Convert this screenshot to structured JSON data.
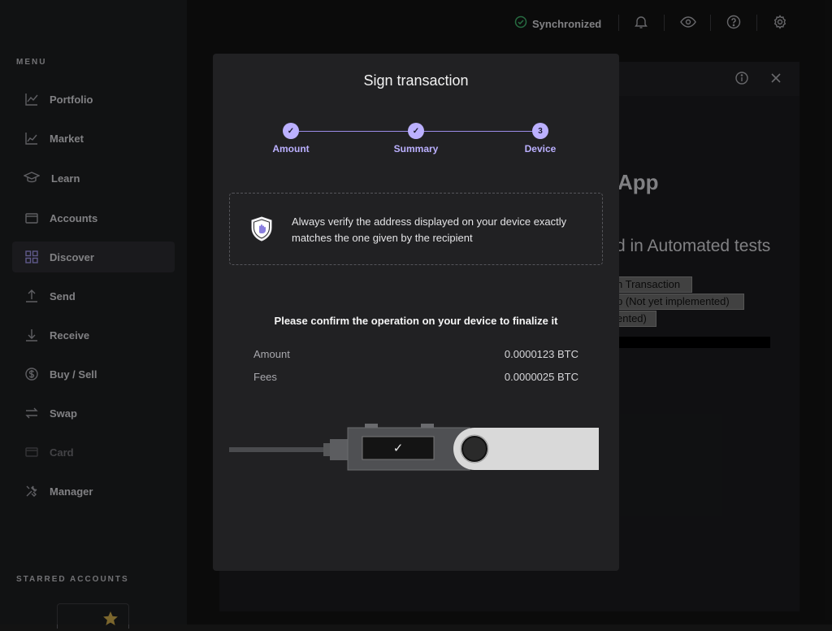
{
  "sidebar": {
    "menu_title": "MENU",
    "items": [
      {
        "label": "Portfolio",
        "icon": "chart-line-icon"
      },
      {
        "label": "Market",
        "icon": "market-chart-icon"
      },
      {
        "label": "Learn",
        "icon": "graduation-cap-icon"
      },
      {
        "label": "Accounts",
        "icon": "wallet-icon"
      },
      {
        "label": "Discover",
        "icon": "grid-icon"
      },
      {
        "label": "Send",
        "icon": "arrow-up-icon"
      },
      {
        "label": "Receive",
        "icon": "arrow-down-icon"
      },
      {
        "label": "Buy / Sell",
        "icon": "dollar-icon"
      },
      {
        "label": "Swap",
        "icon": "swap-arrows-icon"
      },
      {
        "label": "Card",
        "icon": "card-icon"
      },
      {
        "label": "Manager",
        "icon": "tools-icon"
      }
    ],
    "active_item": "Discover",
    "starred_title": "STARRED ACCOUNTS"
  },
  "topbar": {
    "sync_status": "Synchronized"
  },
  "background_panel": {
    "app_title": "App",
    "subtitle": "d in Automated tests",
    "buttons": [
      "n Transaction",
      "p (Not yet implemented)",
      "ented)"
    ]
  },
  "modal": {
    "title": "Sign transaction",
    "steps": [
      {
        "label": "Amount",
        "state": "done",
        "marker": "✓"
      },
      {
        "label": "Summary",
        "state": "done",
        "marker": "✓"
      },
      {
        "label": "Device",
        "state": "current",
        "marker": "3"
      }
    ],
    "warning": "Always verify the address displayed on your device exactly matches the one given by the recipient",
    "confirm_message": "Please confirm the operation on your device to finalize it",
    "rows": [
      {
        "label": "Amount",
        "value": "0.0000123 BTC"
      },
      {
        "label": "Fees",
        "value": "0.0000025 BTC"
      }
    ],
    "device_screen_glyph": "✓"
  },
  "colors": {
    "accent": "#bbb0ff",
    "sync_ok": "#6fcf97",
    "background": "#131313",
    "modal_bg": "#212123"
  }
}
